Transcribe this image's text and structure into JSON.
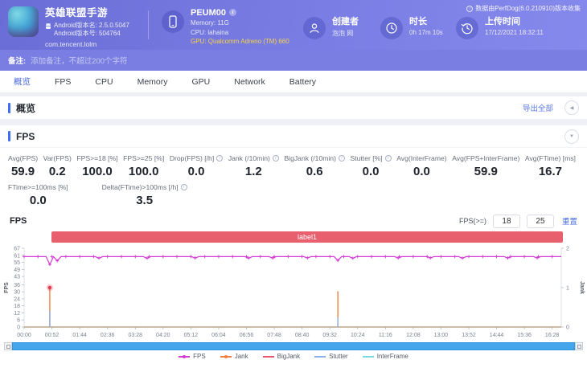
{
  "header": {
    "app": {
      "name": "英雄联盟手游",
      "android_version_name": "Android版本名: 2.5.0.5047",
      "android_version_code": "Android版本号: 504764",
      "package": "com.tencent.lolm"
    },
    "device": {
      "model": "PEUM00",
      "memory": "Memory: 11G",
      "cpu": "CPU: lahaina",
      "gpu": "GPU: Qualcomm Adreno (TM) 660"
    },
    "creator": {
      "label": "创建者",
      "value": "泡泡 网"
    },
    "duration": {
      "label": "时长",
      "value": "0h 17m 10s"
    },
    "upload": {
      "label": "上传时间",
      "value": "17/12/2021 18:32:11"
    },
    "collect_note": "数据由PerfDog(6.0.210910)版本收集"
  },
  "remarks": {
    "label": "备注:",
    "placeholder": "添加备注，不超过200个字符"
  },
  "tabs": [
    {
      "name": "overview",
      "label": "概览",
      "active": true
    },
    {
      "name": "fps",
      "label": "FPS",
      "active": false
    },
    {
      "name": "cpu",
      "label": "CPU",
      "active": false
    },
    {
      "name": "memory",
      "label": "Memory",
      "active": false
    },
    {
      "name": "gpu",
      "label": "GPU",
      "active": false
    },
    {
      "name": "network",
      "label": "Network",
      "active": false
    },
    {
      "name": "battery",
      "label": "Battery",
      "active": false
    }
  ],
  "overview": {
    "title": "概览",
    "export_all": "导出全部"
  },
  "fps_section": {
    "title": "FPS",
    "chart_title": "FPS",
    "threshold_label": "FPS(>=)",
    "threshold_low": "18",
    "threshold_high": "25",
    "reset_label": "重置",
    "metrics_row1": [
      {
        "label": "Avg(FPS)",
        "value": "59.9",
        "info": false
      },
      {
        "label": "Var(FPS)",
        "value": "0.2",
        "info": false
      },
      {
        "label": "FPS>=18 [%]",
        "value": "100.0",
        "info": false
      },
      {
        "label": "FPS>=25 [%]",
        "value": "100.0",
        "info": false
      },
      {
        "label": "Drop(FPS) [/h]",
        "value": "0.0",
        "info": true
      },
      {
        "label": "Jank (/10min)",
        "value": "1.2",
        "info": true
      },
      {
        "label": "BigJank (/10min)",
        "value": "0.6",
        "info": true
      },
      {
        "label": "Stutter [%]",
        "value": "0.0",
        "info": true
      },
      {
        "label": "Avg(InterFrame)",
        "value": "0.0",
        "info": false
      },
      {
        "label": "Avg(FPS+InterFrame)",
        "value": "59.9",
        "info": false
      },
      {
        "label": "Avg(FTime) [ms]",
        "value": "16.7",
        "info": false
      }
    ],
    "metrics_row2": [
      {
        "label": "FTime>=100ms [%]",
        "value": "0.0",
        "info": false
      },
      {
        "label": "Delta(FTime)>100ms [/h]",
        "value": "3.5",
        "info": true
      }
    ]
  },
  "chart_data": {
    "type": "line",
    "title": "FPS",
    "band_label": "label1",
    "duration_sec": 1005,
    "tick_interval_sec": 52,
    "x_ticks": [
      "00:00",
      "00:52",
      "01:44",
      "02:36",
      "03:28",
      "04:20",
      "05:12",
      "06:04",
      "06:56",
      "07:48",
      "08:40",
      "09:32",
      "10:24",
      "11:16",
      "12:08",
      "13:00",
      "13:52",
      "14:44",
      "15:36",
      "16:28"
    ],
    "y_left": {
      "label": "FPS",
      "max": 67,
      "ticks": [
        0,
        6,
        12,
        18,
        24,
        30,
        36,
        43,
        49,
        55,
        61,
        67
      ]
    },
    "y_right": {
      "label": "Jank",
      "max": 2,
      "ticks": [
        0,
        1,
        2
      ]
    },
    "series": [
      {
        "name": "FPS",
        "color": "#d23bd2",
        "baseline": 59.9,
        "marker_step_sec": 26,
        "dips": [
          [
            48,
            53.2
          ],
          [
            62,
            56.3
          ],
          [
            140,
            58.6
          ],
          [
            230,
            58.5
          ],
          [
            320,
            58.7
          ],
          [
            420,
            58.6
          ],
          [
            465,
            58.7
          ],
          [
            530,
            58.8
          ],
          [
            587,
            56.6
          ],
          [
            615,
            58.5
          ],
          [
            700,
            58.7
          ],
          [
            760,
            58.8
          ],
          [
            820,
            58.6
          ],
          [
            905,
            58.7
          ],
          [
            960,
            58.8
          ]
        ]
      },
      {
        "name": "Jank",
        "color": "#f08044",
        "spikes": [
          [
            48,
            33.5
          ],
          [
            587,
            30.5
          ]
        ]
      },
      {
        "name": "BigJank",
        "color": "#e0324b",
        "points": [
          [
            48,
            33.5
          ]
        ]
      },
      {
        "name": "Stutter",
        "color": "#8cb0e8",
        "spikes": [
          [
            48,
            13.5
          ],
          [
            587,
            8.0
          ]
        ]
      },
      {
        "name": "InterFrame",
        "color": "#79d6e3",
        "baseline": 0
      }
    ],
    "legend": [
      {
        "name": "FPS",
        "color": "#d23bd2"
      },
      {
        "name": "Jank",
        "color": "#f08044"
      },
      {
        "name": "BigJank",
        "color": "#e8556d"
      },
      {
        "name": "Stutter",
        "color": "#8cb0e8"
      },
      {
        "name": "InterFrame",
        "color": "#79d6e3"
      }
    ],
    "grid": false,
    "legend_position": "bottom"
  }
}
